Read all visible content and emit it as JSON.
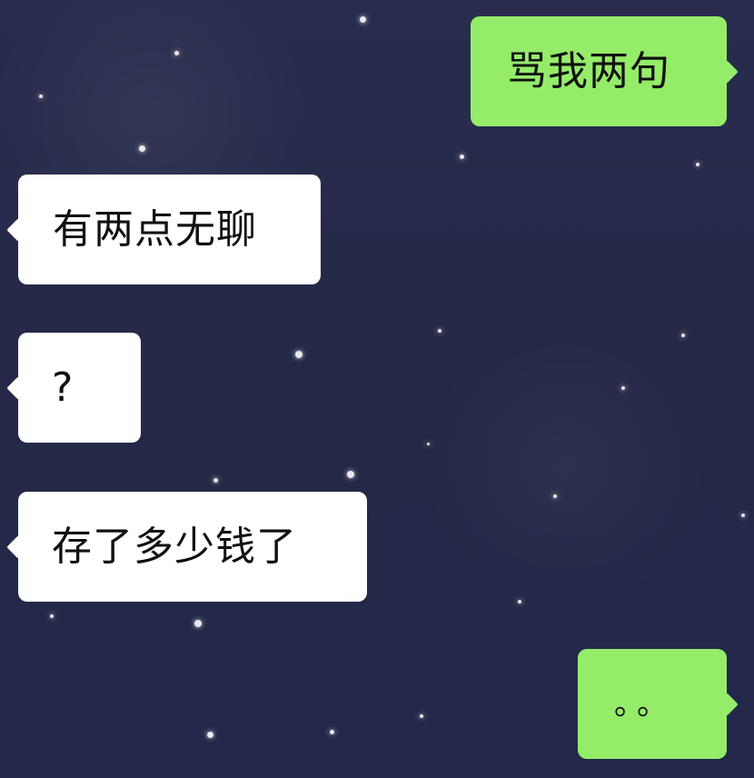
{
  "conversation": {
    "messages": [
      {
        "side": "outgoing",
        "text": "骂我两句"
      },
      {
        "side": "incoming",
        "text": "有两点无聊"
      },
      {
        "side": "incoming",
        "text": "?"
      },
      {
        "side": "incoming",
        "text": "存了多少钱了"
      },
      {
        "side": "outgoing",
        "text": "。。"
      }
    ]
  },
  "colors": {
    "background": "#262a4a",
    "incoming_bubble": "#ffffff",
    "outgoing_bubble": "#95ec69",
    "message_text": "#111111",
    "stars": "#ffffff"
  }
}
